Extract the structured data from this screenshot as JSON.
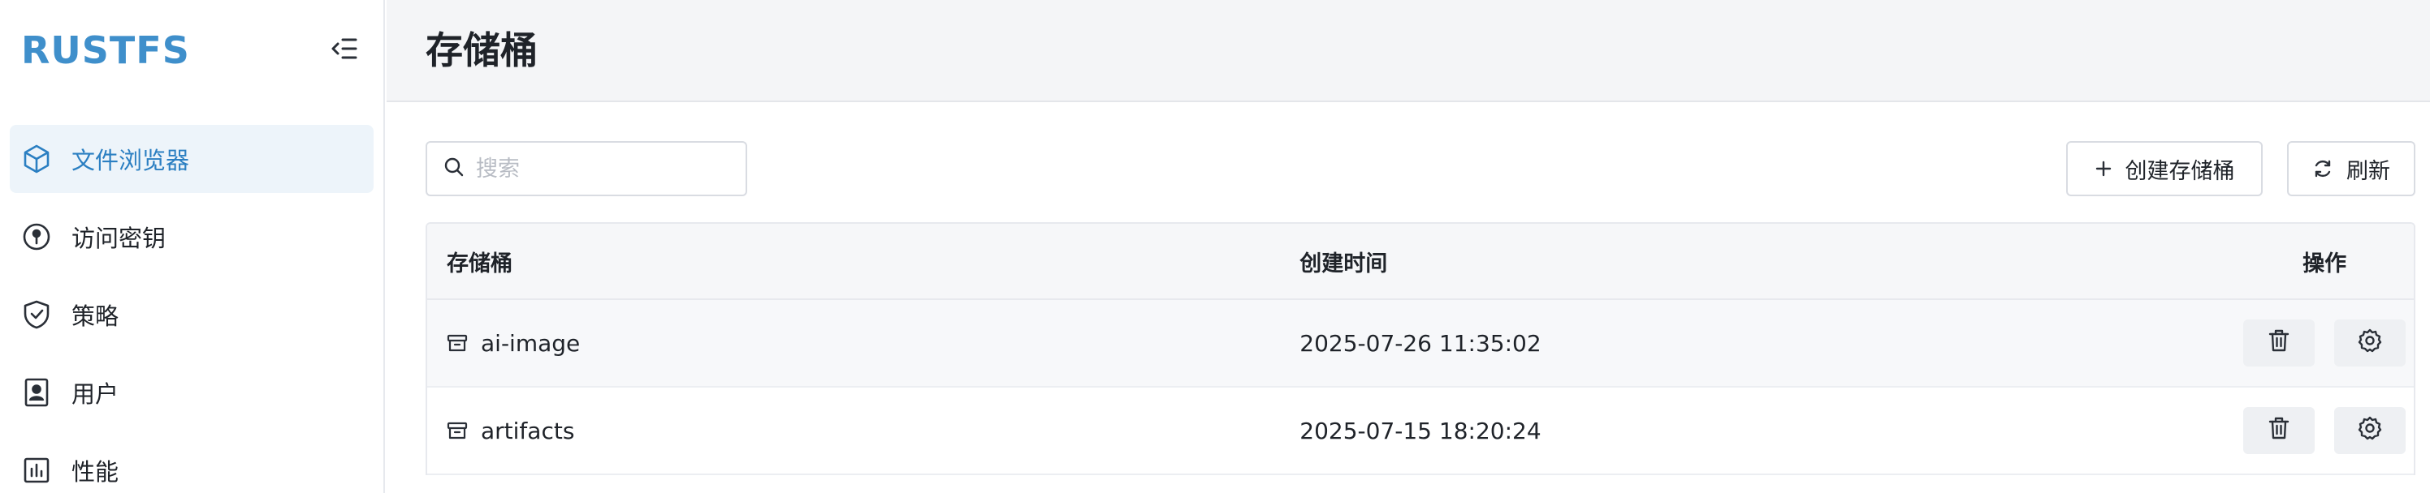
{
  "brand": {
    "logo_text": "RUSTFS",
    "color": "#3f8fcb"
  },
  "sidebar": {
    "collapse_icon": "sidebar-collapse-icon",
    "items": [
      {
        "label": "文件浏览器",
        "icon": "cube-icon",
        "active": true
      },
      {
        "label": "访问密钥",
        "icon": "key-circle-icon",
        "active": false
      },
      {
        "label": "策略",
        "icon": "shield-check-icon",
        "active": false
      },
      {
        "label": "用户",
        "icon": "user-badge-icon",
        "active": false
      },
      {
        "label": "性能",
        "icon": "bar-chart-icon",
        "active": false
      }
    ]
  },
  "header": {
    "title": "存储桶"
  },
  "toolbar": {
    "search_placeholder": "搜索",
    "create_label": "创建存储桶",
    "refresh_label": "刷新"
  },
  "table": {
    "columns": [
      "存储桶",
      "创建时间",
      "操作"
    ],
    "rows": [
      {
        "name": "ai-image",
        "created": "2025-07-26 11:35:02"
      },
      {
        "name": "artifacts",
        "created": "2025-07-15 18:20:24"
      }
    ]
  },
  "colors": {
    "accent": "#2b7fc2",
    "active_bg": "#edf4fa",
    "header_bg": "#f4f5f7"
  }
}
